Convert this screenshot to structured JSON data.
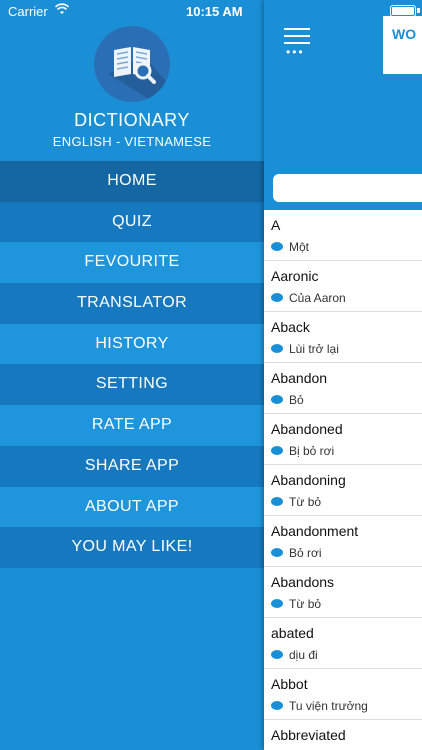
{
  "status": {
    "carrier": "Carrier",
    "time": "10:15 AM"
  },
  "drawer": {
    "title": "DICTIONARY",
    "subtitle": "ENGLISH - VIETNAMESE",
    "menu": [
      {
        "label": "HOME"
      },
      {
        "label": "QUIZ"
      },
      {
        "label": "FEVOURITE"
      },
      {
        "label": "TRANSLATOR"
      },
      {
        "label": "HISTORY"
      },
      {
        "label": "SETTING"
      },
      {
        "label": "RATE APP"
      },
      {
        "label": "SHARE APP"
      },
      {
        "label": "ABOUT APP"
      },
      {
        "label": "YOU MAY LIKE!"
      }
    ]
  },
  "main": {
    "tab_label": "WO",
    "search": {
      "placeholder": ""
    },
    "words": [
      {
        "word": "A",
        "meaning": "Một"
      },
      {
        "word": "Aaronic",
        "meaning": "Của Aaron"
      },
      {
        "word": "Aback",
        "meaning": "Lùi trở lại"
      },
      {
        "word": "Abandon",
        "meaning": "Bỏ"
      },
      {
        "word": "Abandoned",
        "meaning": "Bị bỏ rơi"
      },
      {
        "word": "Abandoning",
        "meaning": "Từ bỏ"
      },
      {
        "word": "Abandonment",
        "meaning": "Bỏ rơi"
      },
      {
        "word": "Abandons",
        "meaning": "Từ bỏ"
      },
      {
        "word": "abated",
        "meaning": "dịu đi"
      },
      {
        "word": "Abbot",
        "meaning": "Tu viện trưởng"
      },
      {
        "word": "Abbreviated",
        "meaning": ""
      }
    ]
  },
  "colors": {
    "primary": "#1b8fd6",
    "active_menu": "#1467a3",
    "logo_bg": "#2a6fb5"
  }
}
